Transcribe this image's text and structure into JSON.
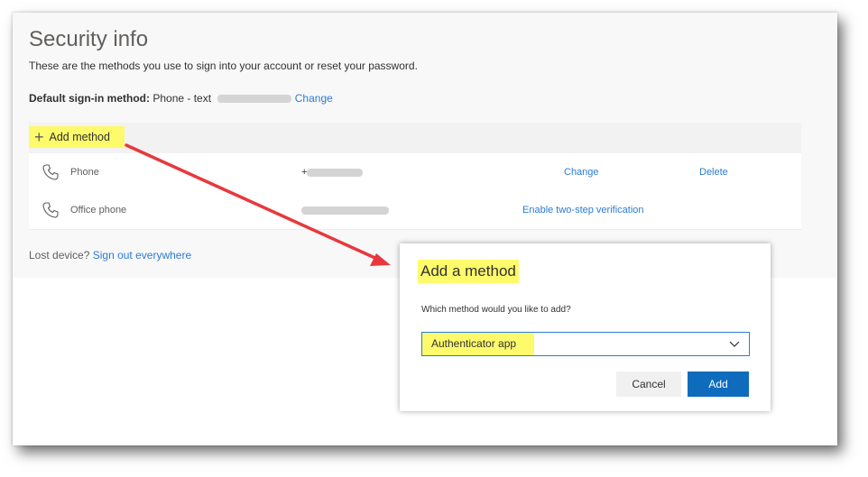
{
  "page": {
    "title": "Security info",
    "subtitle": "These are the methods you use to sign into your account or reset your password.",
    "default_label": "Default sign-in method:",
    "default_value": "Phone - text",
    "default_change": "Change",
    "add_method": "Add method",
    "lost_device": "Lost device?",
    "sign_out": "Sign out everywhere"
  },
  "methods": [
    {
      "label": "Phone",
      "value": "+",
      "action1": "Change",
      "action2": "Delete"
    },
    {
      "label": "Office phone",
      "value": "",
      "action1": "Enable two-step verification",
      "action2": ""
    }
  ],
  "modal": {
    "title": "Add a method",
    "question": "Which method would you like to add?",
    "selected": "Authenticator app",
    "cancel": "Cancel",
    "add": "Add"
  },
  "colors": {
    "highlight": "#fdfa6b",
    "link": "#2b7cd3",
    "primary_button": "#0f6cbd",
    "arrow": "#e8383d"
  },
  "icons": {
    "add": "plus-icon",
    "phone": "phone-icon",
    "dropdown": "chevron-down-icon"
  }
}
